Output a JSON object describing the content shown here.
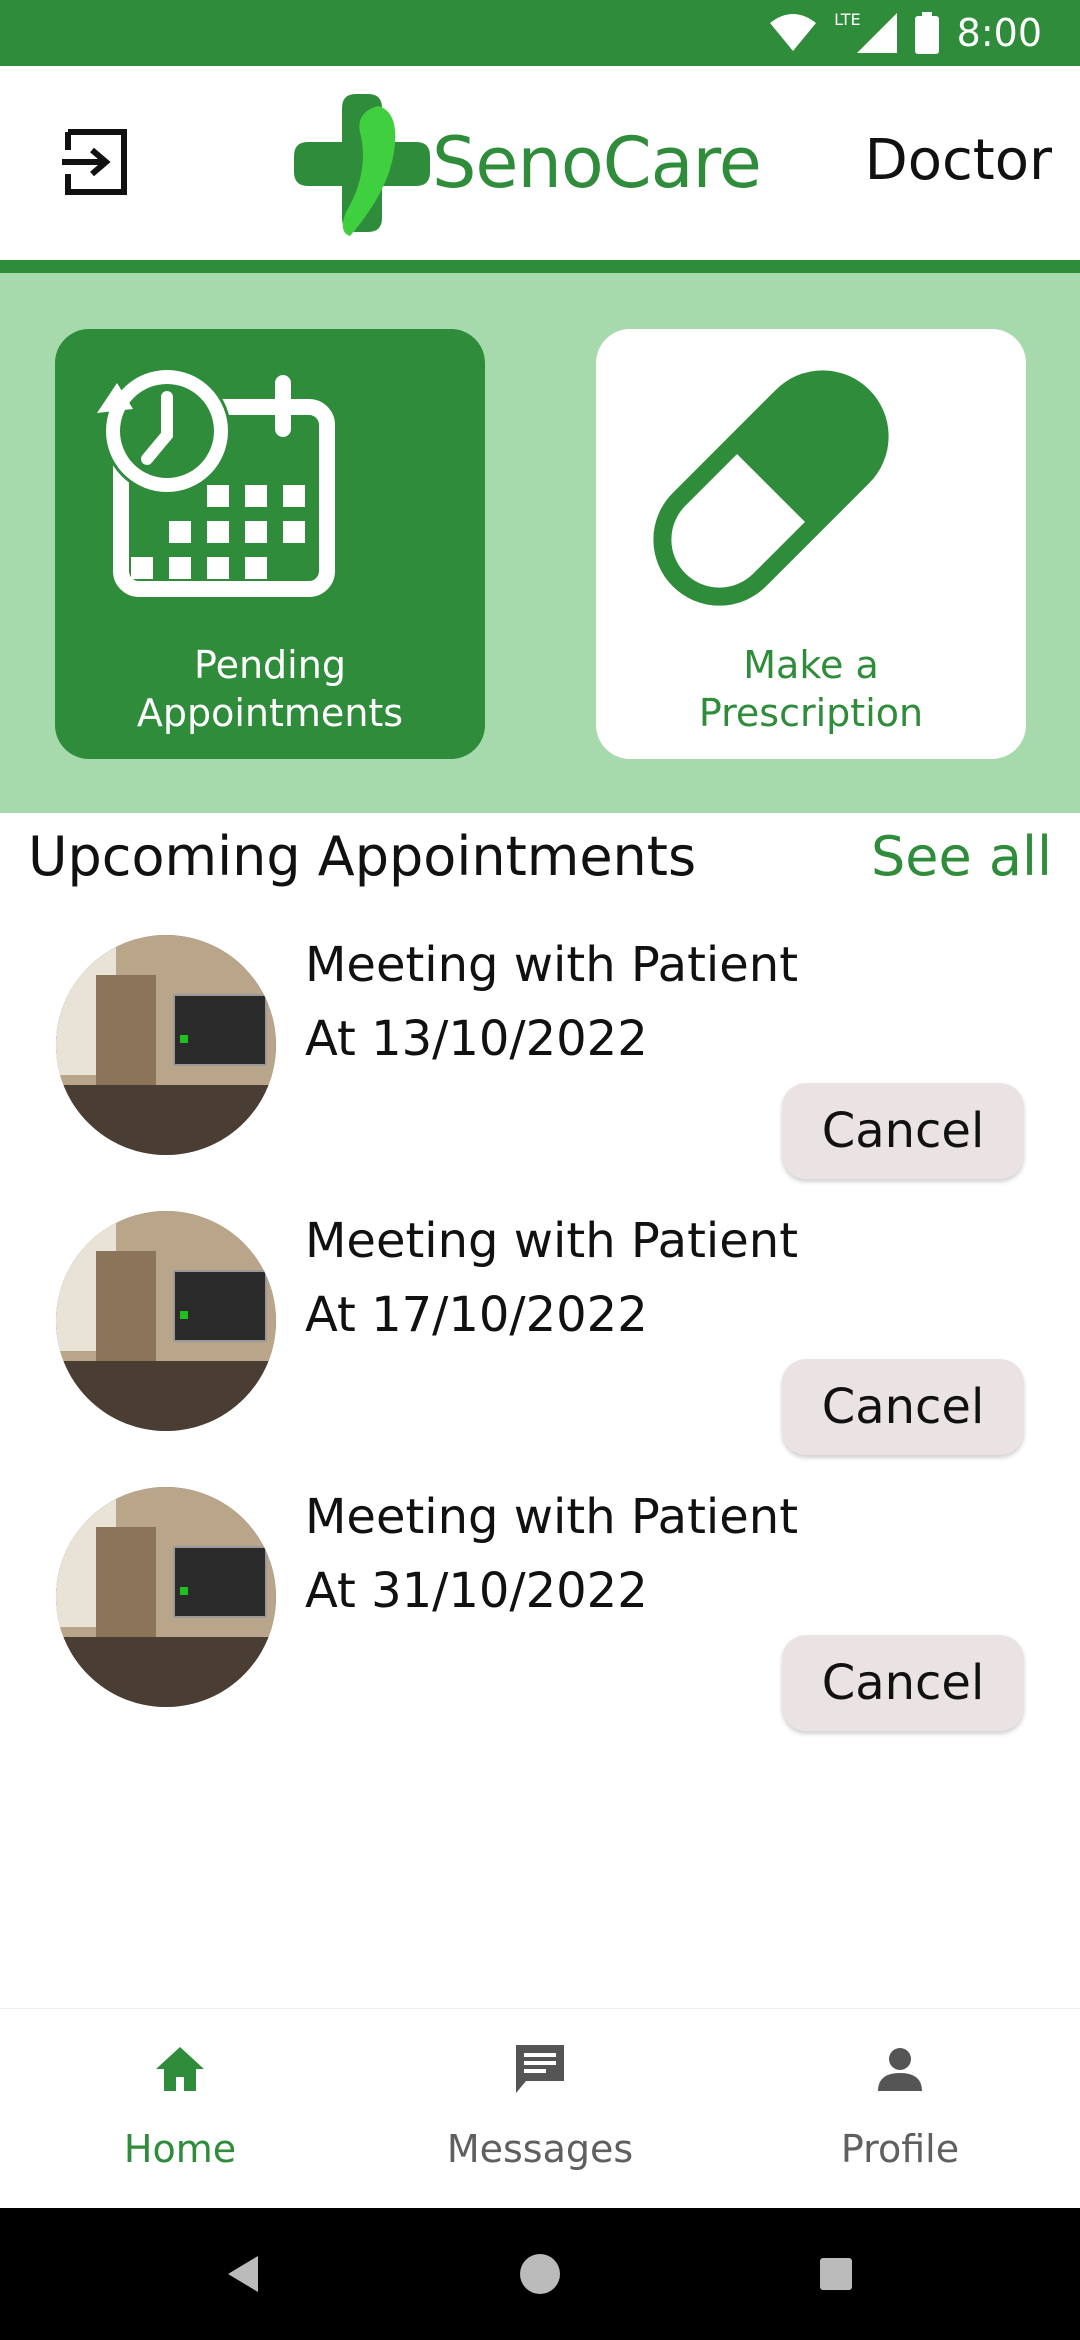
{
  "status_bar": {
    "time": "8:00",
    "network": "LTE",
    "icons": [
      "wifi-icon",
      "signal-icon",
      "battery-icon"
    ],
    "background": "#2f8c3a"
  },
  "header": {
    "logo_text": "SenoCare",
    "role": "Doctor",
    "logout_icon": "logout-icon"
  },
  "quick_actions": [
    {
      "line1": "Pending",
      "line2": "Appointments",
      "icon": "calendar-clock-icon"
    },
    {
      "line1": "Make a",
      "line2": "Prescription",
      "icon": "pill-icon"
    }
  ],
  "upcoming": {
    "title": "Upcoming Appointments",
    "see_all": "See all",
    "items": [
      {
        "title": "Meeting with Patient",
        "date": "At 13/10/2022",
        "cancel_label": "Cancel"
      },
      {
        "title": "Meeting with Patient",
        "date": "At 17/10/2022",
        "cancel_label": "Cancel"
      },
      {
        "title": "Meeting with Patient",
        "date": "At 31/10/2022",
        "cancel_label": "Cancel"
      }
    ]
  },
  "bottom_nav": [
    {
      "label": "Home",
      "icon": "home-icon",
      "active": true
    },
    {
      "label": "Messages",
      "icon": "message-icon",
      "active": false
    },
    {
      "label": "Profile",
      "icon": "person-icon",
      "active": false
    }
  ],
  "colors": {
    "primary": "#2f8c3a",
    "band": "#a6d9ac",
    "cancel_bg": "#ebe3e3"
  }
}
